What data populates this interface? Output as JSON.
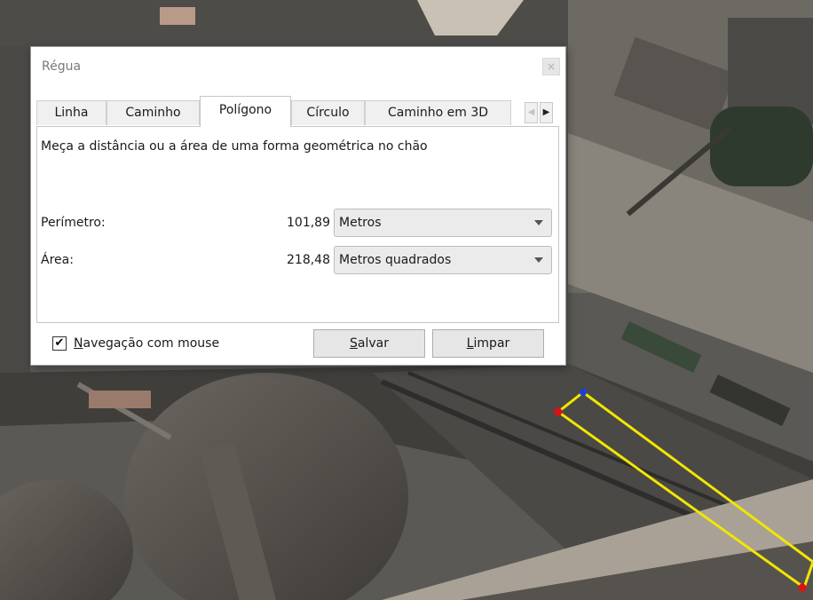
{
  "dialog": {
    "title": "Régua",
    "close_symbol": "×",
    "tabs": [
      {
        "label": "Linha",
        "active": false
      },
      {
        "label": "Caminho",
        "active": false
      },
      {
        "label": "Polígono",
        "active": true
      },
      {
        "label": "Círculo",
        "active": false
      },
      {
        "label": "Caminho em 3D",
        "active": false
      }
    ],
    "tab_scroll": {
      "left_symbol": "◀",
      "right_symbol": "▶"
    },
    "description": "Meça a distância ou a área de uma forma geométrica no chão",
    "perimeter": {
      "label": "Perímetro:",
      "value": "101,89",
      "unit": "Metros"
    },
    "area": {
      "label": "Área:",
      "value": "218,48",
      "unit": "Metros quadrados"
    },
    "mouse_nav": {
      "checked": true,
      "check_symbol": "✔",
      "mnemonic": "N",
      "label_rest": "avegação com mouse"
    },
    "save_button": {
      "mnemonic": "S",
      "label_rest": "alvar"
    },
    "clear_button": {
      "mnemonic": "L",
      "label_rest": "impar"
    }
  },
  "map": {
    "polygon_color": "#f2e600",
    "vertex_colors": {
      "start": "#e01010",
      "active": "#1a3ee0"
    }
  }
}
